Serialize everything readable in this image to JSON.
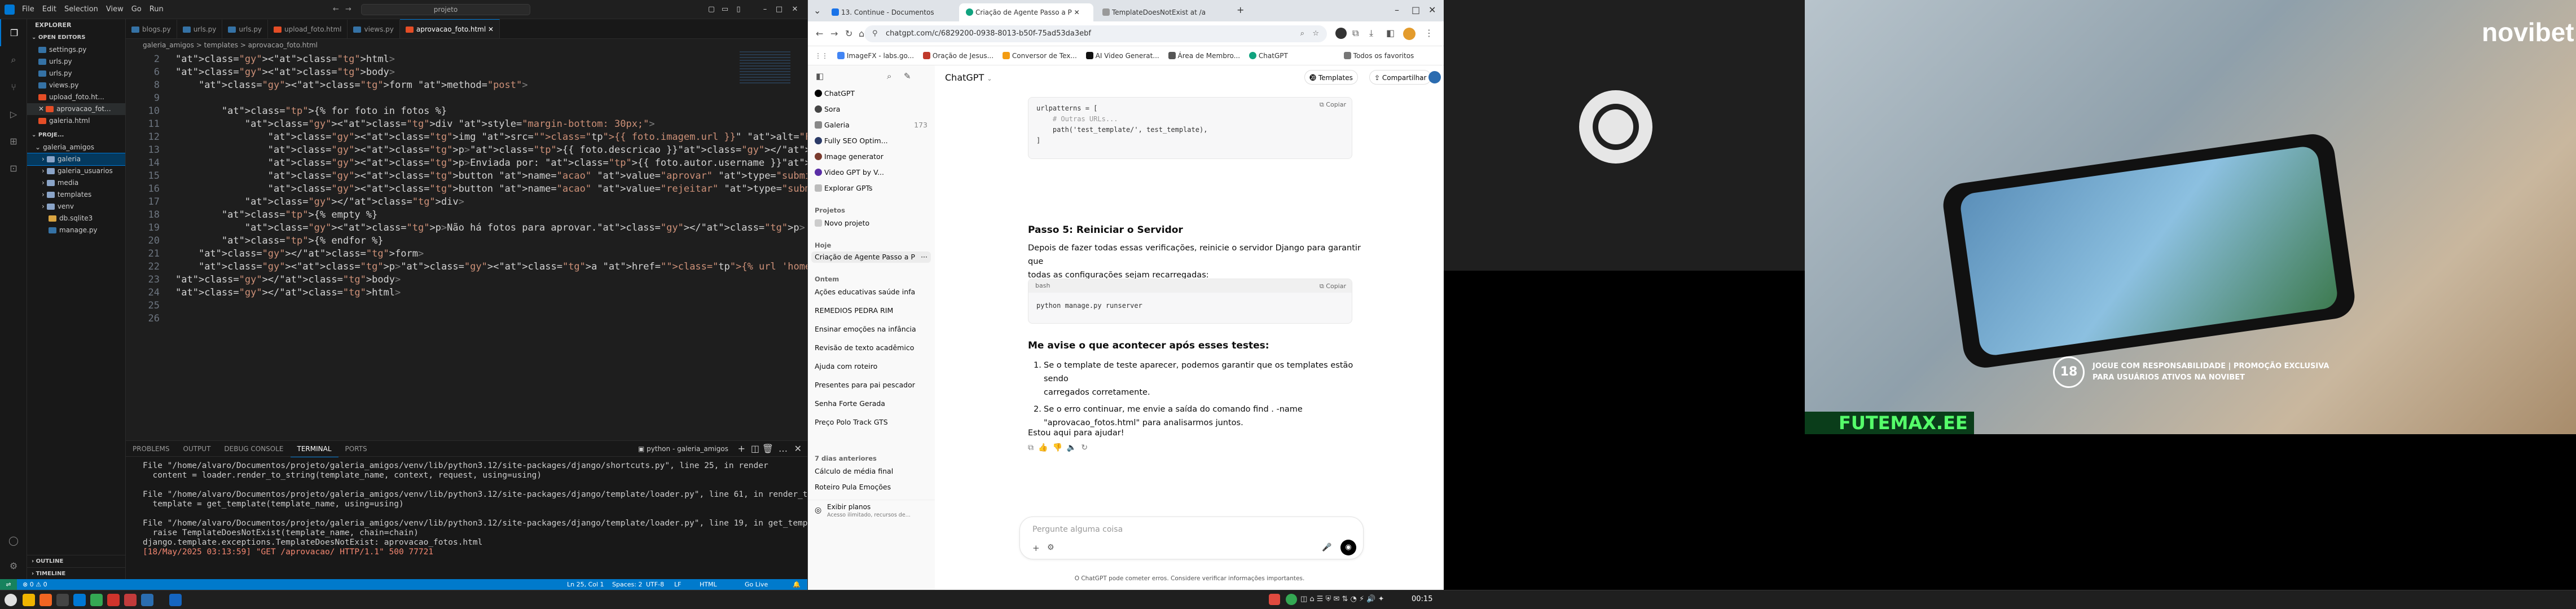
{
  "vscode": {
    "menu": [
      "File",
      "Edit",
      "Selection",
      "View",
      "Go",
      "Run"
    ],
    "search": "projeto",
    "sidebar": {
      "explorer": "EXPLORER",
      "open_editors": "OPEN EDITORS",
      "open_files": [
        "settings.py",
        "urls.py",
        "urls.py",
        "views.py",
        "upload_foto.ht...",
        "aprovacao_fot...",
        "galeria.html"
      ],
      "project": "PROJE...",
      "tree": [
        "galeria_amigos",
        "galeria",
        "galeria_usuarios",
        "media",
        "templates",
        "venv",
        "db.sqlite3",
        "manage.py"
      ],
      "outline": "OUTLINE",
      "timeline": "TIMELINE"
    },
    "tabs": [
      "blogs.py",
      "urls.py",
      "urls.py",
      "upload_foto.html",
      "views.py",
      "aprovacao_foto.html"
    ],
    "breadcrumb": "galeria_amigos > templates > aprovacao_foto.html",
    "line_numbers": [
      "2",
      "6",
      "8",
      "9",
      "10",
      "11",
      "12",
      "13",
      "14",
      "15",
      "16",
      "17",
      "18",
      "19",
      "20",
      "21",
      "22",
      "23",
      "24",
      "25",
      "26"
    ],
    "code": [
      "<html>",
      "<body>",
      "    <form method=\"post\">",
      "",
      "        {% for foto in fotos %}",
      "            <div style=\"margin-bottom: 30px;\">",
      "                <img src=\"{{ foto.imagem.url }}\" alt=\"Foto\" width=\"300\">",
      "                <p>{{ foto.descricao }}</p>",
      "                <p>Enviada por: {{ foto.autor.username }}</p>",
      "                <button name=\"acao\" value=\"aprovar\" type=\"submit\" formaction=\"?foto_id={{ fo",
      "                <button name=\"acao\" value=\"rejeitar\" type=\"submit\" formaction=\"?foto_id={{ fo",
      "            </div>",
      "        {% empty %}",
      "            <p>Não há fotos para aprovar.</p>",
      "        {% endfor %}",
      "    </form>",
      "    <p><a href=\"{% url 'home' %}\">Voltar</a></p>",
      "</body>",
      "</html>",
      "",
      ""
    ],
    "panel_tabs": [
      "PROBLEMS",
      "OUTPUT",
      "DEBUG CONSOLE",
      "TERMINAL",
      "PORTS"
    ],
    "terminal_label": "python - galeria_amigos",
    "terminal": [
      "File \"/home/alvaro/Documentos/projeto/galeria_amigos/venv/lib/python3.12/site-packages/django/shortcuts.py\", line 25, in render",
      "  content = loader.render_to_string(template_name, context, request, using=using)",
      "",
      "File \"/home/alvaro/Documentos/projeto/galeria_amigos/venv/lib/python3.12/site-packages/django/template/loader.py\", line 61, in render_to_string",
      "  template = get_template(template_name, using=using)",
      "",
      "File \"/home/alvaro/Documentos/projeto/galeria_amigos/venv/lib/python3.12/site-packages/django/template/loader.py\", line 19, in get_template",
      "  raise TemplateDoesNotExist(template_name, chain=chain)",
      "django.template.exceptions.TemplateDoesNotExist: aprovacao_fotos.html",
      "[18/May/2025 03:13:59] \"GET /aprovacao/ HTTP/1.1\" 500 77721"
    ],
    "status": {
      "left": "⊗ 0 ⚠ 0",
      "pos": "Ln 25, Col 1",
      "spaces": "Spaces: 2",
      "enc": "UTF-8",
      "eol": "LF",
      "lang": "HTML",
      "live": "Go Live"
    }
  },
  "chrome": {
    "tabs": [
      "13. Continue - Documentos",
      "Criação de Agente Passo a P",
      "TemplateDoesNotExist at /a"
    ],
    "url": "chatgpt.com/c/6829200-0938-8013-b50f-75ad53da3ebf",
    "bookmarks": [
      "ImageFX - labs.go...",
      "Oração de Jesus...",
      "Conversor de Tex...",
      "AI Video Generat...",
      "Área de Membro...",
      "ChatGPT",
      "Todos os favoritos"
    ],
    "sidebar": {
      "items": [
        "ChatGPT",
        "Sora",
        "Galeria",
        "Fully SEO Optim...",
        "Image generator",
        "Video GPT by V...",
        "Explorar GPTs"
      ],
      "galeria_count": "173",
      "projects_label": "Projetos",
      "new_project": "Novo projeto",
      "today_label": "Hoje",
      "today": [
        "Criação de Agente Passo a P"
      ],
      "yesterday_label": "Ontem",
      "yesterday": [
        "Ações educativas saúde infa",
        "REMEDIOS PEDRA RIM",
        "Ensinar emoções na infância",
        "Revisão de texto acadêmico",
        "Ajuda com roteiro",
        "Presentes para pai pescador",
        "Senha Forte Gerada",
        "Preço Polo Track GTS"
      ],
      "week_label": "7 dias anteriores",
      "week": [
        "Cálculo de média final",
        "Roteiro Pula Emoções"
      ],
      "plans": "Exibir planos",
      "plans_sub": "Acesso ilimitado, recursos de..."
    },
    "header": {
      "model": "ChatGPT",
      "templates": "Templates",
      "share": "Compartilhar"
    },
    "urlpatterns_code": [
      "urlpatterns = [",
      "    # Outras URLs...",
      "    path('test_template/', test_template),",
      "]"
    ],
    "copy": "Copiar",
    "step5_title": "Passo 5: Reiniciar o Servidor",
    "step5_text": [
      "Depois de fazer todas essas verificações, reinicie o servidor Django para garantir que",
      "todas as configurações sejam recarregadas:"
    ],
    "bash_label": "bash",
    "bash_cmd": "python manage.py runserver",
    "tell_title": "Me avise o que acontecer após esses testes:",
    "list": [
      "Se o template de teste aparecer, podemos garantir que os templates estão sendo",
      "carregados corretamente.",
      "Se o erro continuar, me envie a saída do comando find . -name",
      "\"aprovacao_fotos.html\" para analisarmos juntos."
    ],
    "help": "Estou aqui para ajudar!",
    "input_placeholder": "Pergunte alguma coisa",
    "disclaimer": "O ChatGPT pode cometer erros. Considere verificar informações importantes."
  },
  "video": {
    "brand": "novibet",
    "age": "18",
    "promo": [
      "JOGUE COM RESPONSABILIDADE | PROMOÇÃO EXCLUSIVA",
      "PARA USUÁRIOS ATIVOS NA NOVIBET"
    ],
    "ticker": "FUTEMAX.EE"
  },
  "taskbar": {
    "clock": "00:15"
  },
  "colors": {
    "accent": "#007acc",
    "chrome_bg": "#dfe3e8",
    "gpt_dark": "#0d0d0d"
  }
}
